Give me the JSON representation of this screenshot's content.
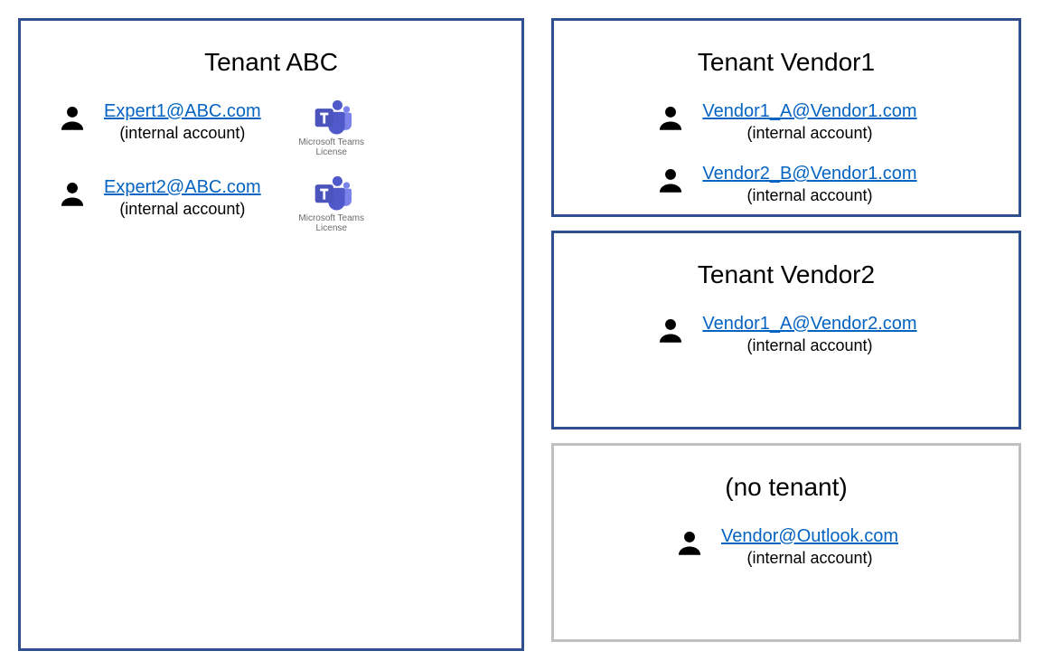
{
  "tenants": {
    "abc": {
      "title": "Tenant ABC",
      "users": [
        {
          "email": "Expert1@ABC.com",
          "sub": "(internal account)",
          "license": "Microsoft Teams License"
        },
        {
          "email": "Expert2@ABC.com",
          "sub": "(internal account)",
          "license": "Microsoft Teams License"
        }
      ]
    },
    "vendor1": {
      "title": "Tenant Vendor1",
      "users": [
        {
          "email": "Vendor1_A@Vendor1.com",
          "sub": "(internal account)"
        },
        {
          "email": "Vendor2_B@Vendor1.com",
          "sub": "(internal account)"
        }
      ]
    },
    "vendor2": {
      "title": "Tenant Vendor2",
      "users": [
        {
          "email": "Vendor1_A@Vendor2.com",
          "sub": "(internal account)"
        }
      ]
    },
    "none": {
      "title": "(no tenant)",
      "users": [
        {
          "email": "Vendor@Outlook.com",
          "sub": "(internal account)"
        }
      ]
    }
  },
  "icons": {
    "teams_caption": "Microsoft Teams\nLicense"
  }
}
